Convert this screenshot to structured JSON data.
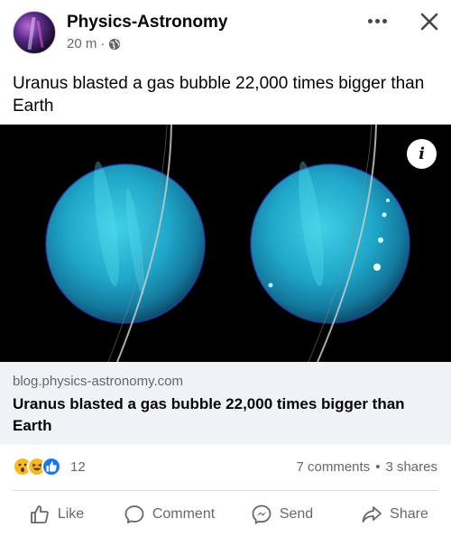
{
  "post": {
    "page_name": "Physics-Astronomy",
    "time": "20 m",
    "separator": "·",
    "audience_icon": "globe-icon",
    "text": "Uranus blasted a gas bubble 22,000 times bigger than Earth"
  },
  "header_actions": {
    "more_icon": "more-options-icon",
    "close_icon": "close-icon"
  },
  "media": {
    "info_label": "i"
  },
  "link_preview": {
    "domain": "blog.physics-astronomy.com",
    "title": "Uranus blasted a gas bubble 22,000 times bigger than Earth"
  },
  "engagement": {
    "reactions": [
      "wow",
      "haha",
      "like"
    ],
    "reaction_count": "12",
    "comments": "7 comments",
    "dot": "•",
    "shares": "3 shares"
  },
  "actions": [
    {
      "label": "Like",
      "icon": "thumbs-up-icon"
    },
    {
      "label": "Comment",
      "icon": "comment-bubble-icon"
    },
    {
      "label": "Send",
      "icon": "messenger-icon"
    },
    {
      "label": "Share",
      "icon": "share-arrow-icon"
    }
  ],
  "colors": {
    "accent": "#1877f2",
    "secondary_text": "#65676b",
    "link_card_bg": "#f0f2f5"
  }
}
